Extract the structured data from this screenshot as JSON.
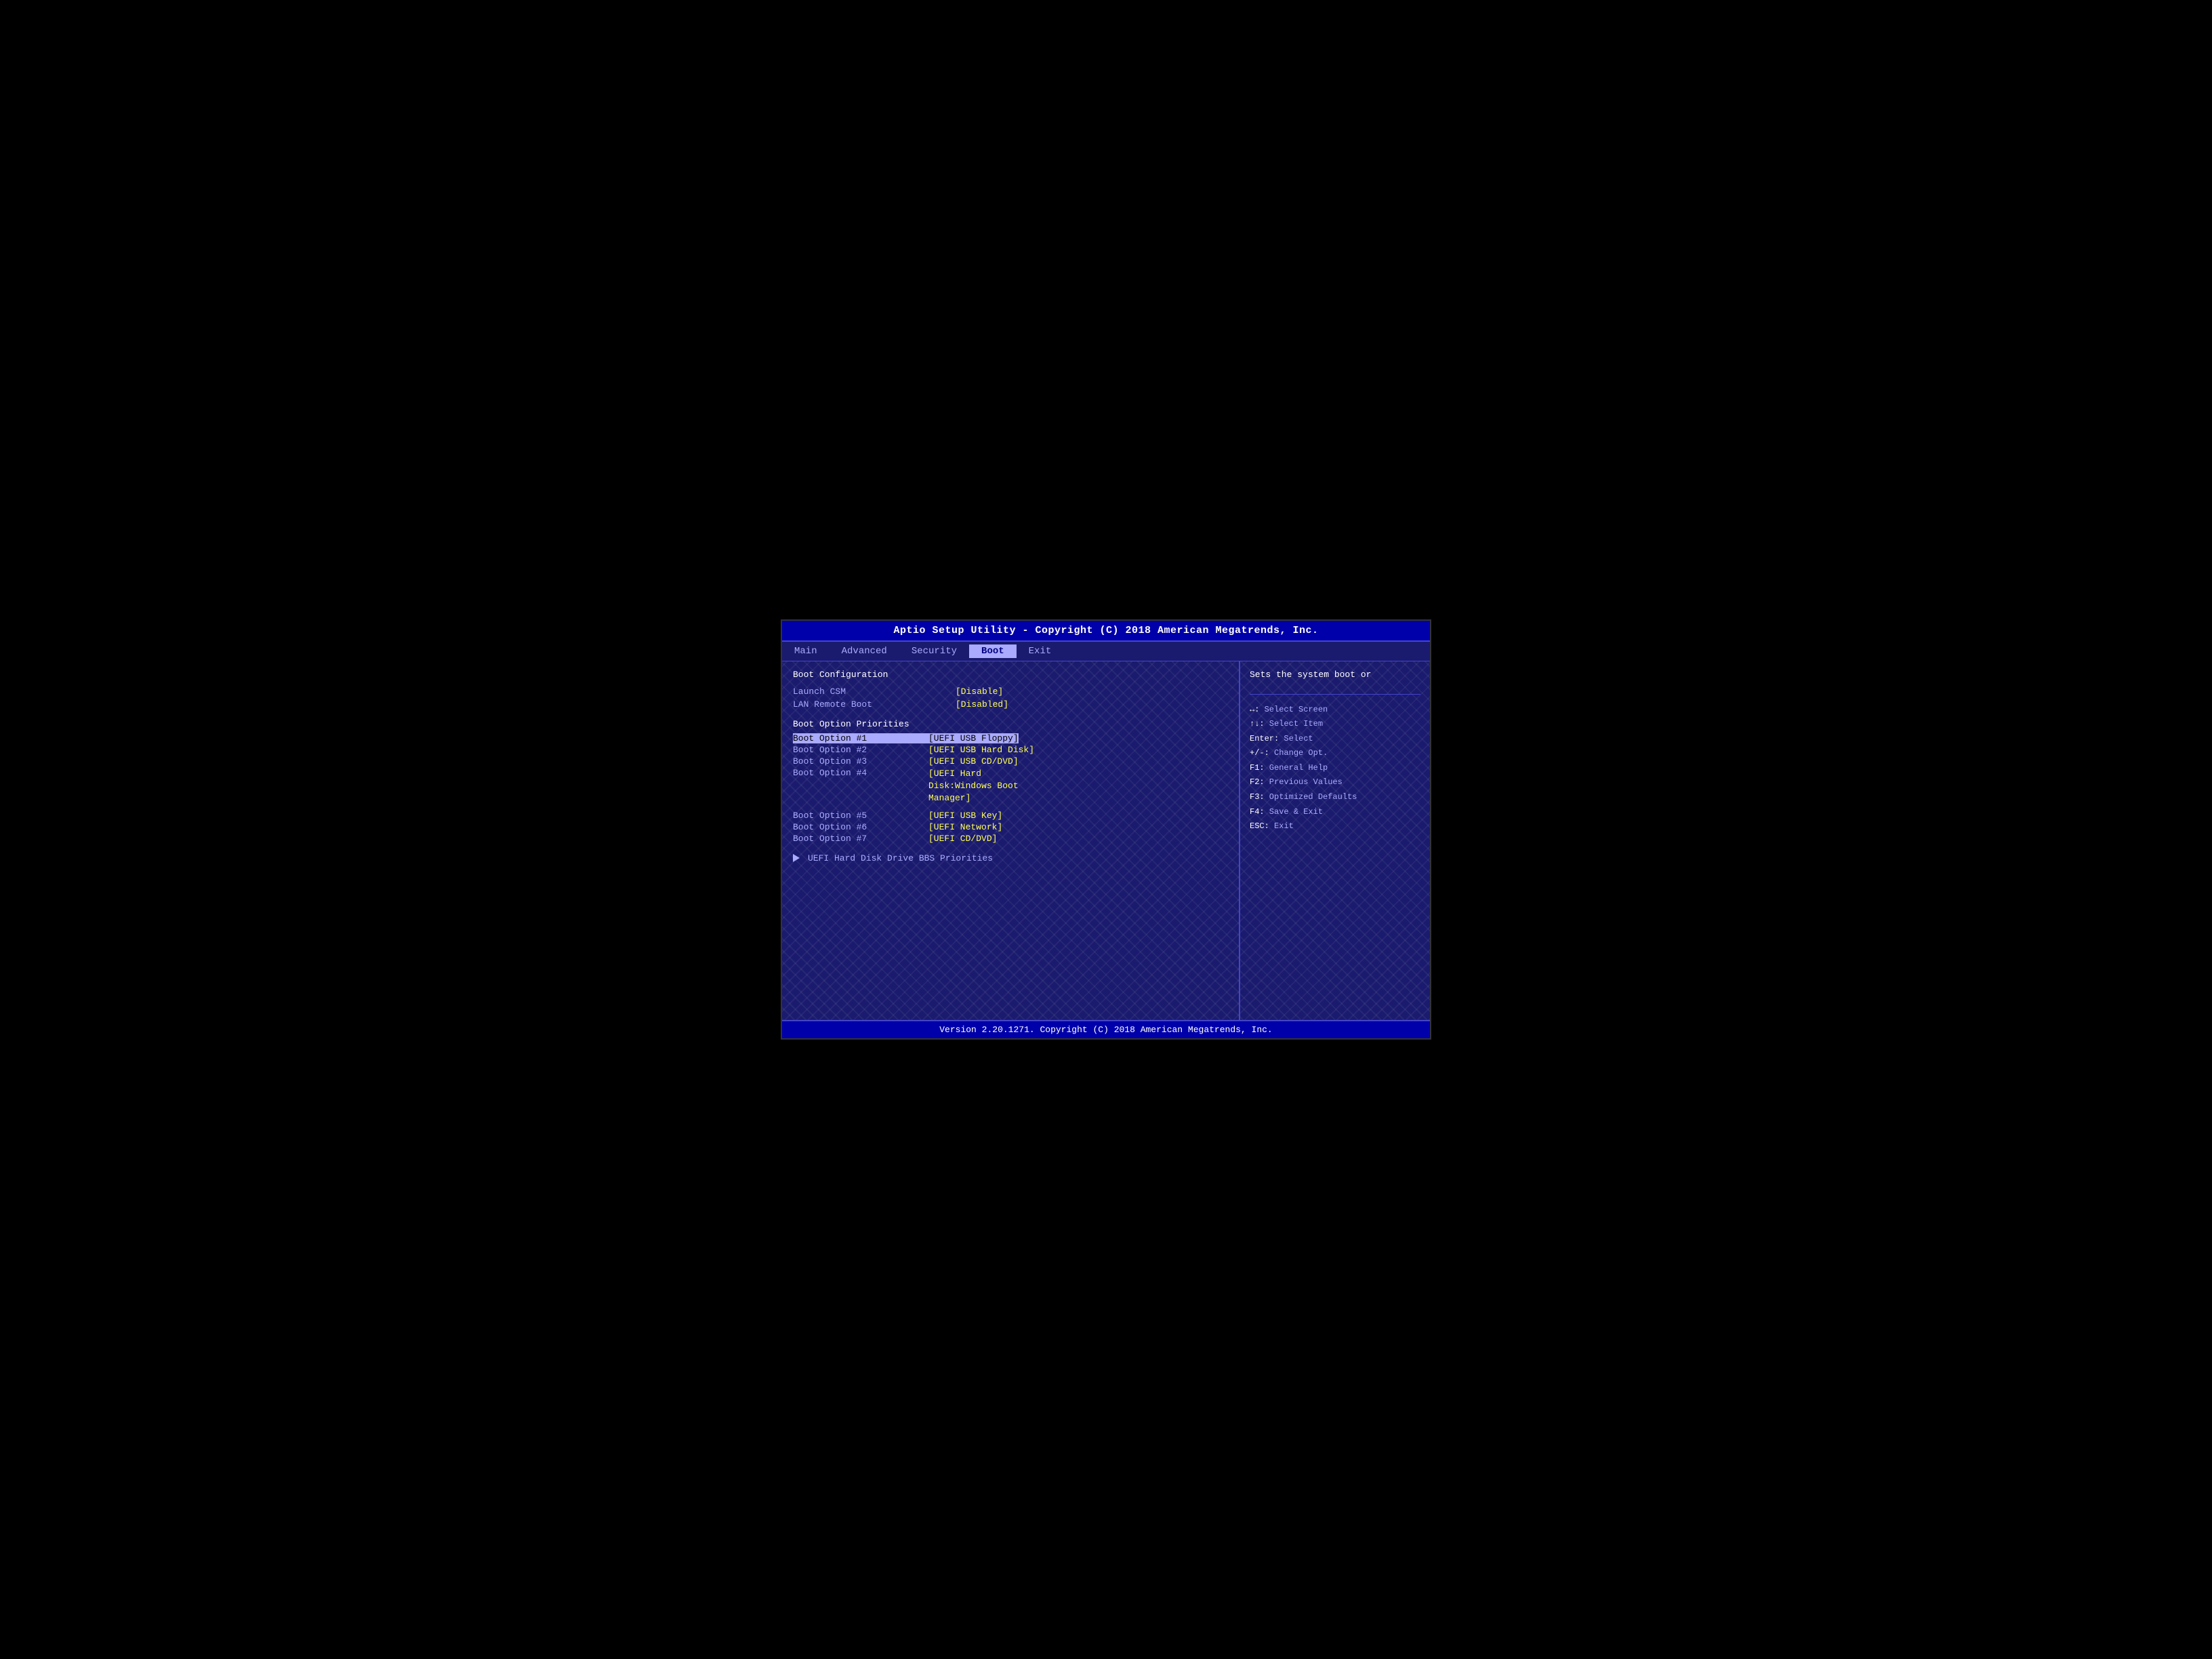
{
  "titleBar": {
    "text": "Aptio Setup Utility - Copyright (C) 2018 American Megatrends, Inc."
  },
  "menuBar": {
    "items": [
      {
        "label": "Main",
        "active": false
      },
      {
        "label": "Advanced",
        "active": false
      },
      {
        "label": "Security",
        "active": false
      },
      {
        "label": "Boot",
        "active": true
      },
      {
        "label": "Exit",
        "active": false
      }
    ]
  },
  "mainPanel": {
    "sectionTitle": "Boot Configuration",
    "configRows": [
      {
        "label": "Launch CSM",
        "value": "[Disable]"
      },
      {
        "label": "LAN Remote Boot",
        "value": "[Disabled]"
      }
    ],
    "bootPrioritiesTitle": "Boot Option Priorities",
    "bootOptions": [
      {
        "label": "Boot Option #1",
        "value": "[UEFI USB Floppy]",
        "highlighted": true
      },
      {
        "label": "Boot Option #2",
        "value": "[UEFI USB Hard Disk]",
        "highlighted": false
      },
      {
        "label": "Boot Option #3",
        "value": "[UEFI USB CD/DVD]",
        "highlighted": false
      },
      {
        "label": "Boot Option #4",
        "value": "[UEFI Hard Disk:Windows Boot Manager]",
        "highlighted": false,
        "multiline": true,
        "lines": [
          "[UEFI Hard",
          "Disk:Windows Boot",
          "Manager]"
        ]
      },
      {
        "label": "Boot Option #5",
        "value": "[UEFI USB Key]",
        "highlighted": false
      },
      {
        "label": "Boot Option #6",
        "value": "[UEFI Network]",
        "highlighted": false
      },
      {
        "label": "Boot Option #7",
        "value": "[UEFI CD/DVD]",
        "highlighted": false
      }
    ],
    "bbsPriorities": "UEFI Hard Disk Drive BBS Priorities"
  },
  "sidePanel": {
    "helpText": "Sets the system boot or",
    "keyHelp": [
      {
        "key": "↔:",
        "desc": "Select Screen"
      },
      {
        "key": "↑↓:",
        "desc": "Select Item"
      },
      {
        "key": "Enter:",
        "desc": "Select"
      },
      {
        "key": "+/-:",
        "desc": "Change Opt."
      },
      {
        "key": "F1:",
        "desc": "General Help"
      },
      {
        "key": "F2:",
        "desc": "Previous Values"
      },
      {
        "key": "F3:",
        "desc": "Optimized Defaults"
      },
      {
        "key": "F4:",
        "desc": "Save & Exit"
      },
      {
        "key": "ESC:",
        "desc": "Exit"
      }
    ]
  },
  "bottomBar": {
    "text": "Version 2.20.1271. Copyright (C) 2018 American Megatrends, Inc."
  }
}
